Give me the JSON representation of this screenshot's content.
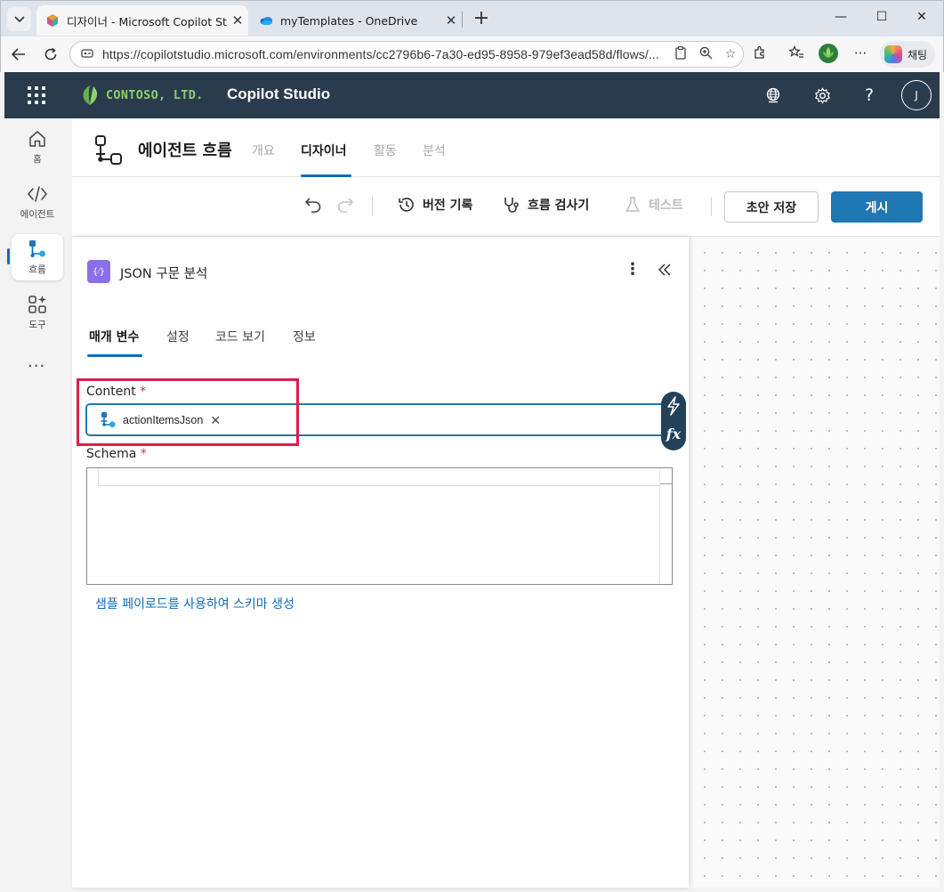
{
  "browser": {
    "tabs": [
      {
        "title": "디자이너 - Microsoft Copilot Studio",
        "close": "✕"
      },
      {
        "title": "myTemplates - OneDrive",
        "close": "✕"
      }
    ],
    "new_tab": "+",
    "window_controls": {
      "minimize": "—",
      "maximize": "☐",
      "close": "✕"
    },
    "url": "https://copilotstudio.microsoft.com/environments/cc2796b6-7a30-ed95-8958-979ef3ead58d/flows/...",
    "chat_label": "채팅",
    "more": "···"
  },
  "app": {
    "brand": "CONTOSO, LTD.",
    "title": "Copilot Studio",
    "avatar_initial": "J",
    "help": "?"
  },
  "rail": {
    "items": [
      {
        "label": "홈",
        "icon": "home-icon"
      },
      {
        "label": "에이전트",
        "icon": "code-icon"
      },
      {
        "label": "흐름",
        "icon": "flow-icon"
      },
      {
        "label": "도구",
        "icon": "tools-icon"
      }
    ],
    "more": "···"
  },
  "page": {
    "title": "에이전트 흐름",
    "tabs": [
      "개요",
      "디자이너",
      "활동",
      "분석"
    ],
    "active_tab": "디자이너"
  },
  "toolbar": {
    "version_history": "버전 기록",
    "flow_checker": "흐름 검사기",
    "test": "테스트",
    "save_draft": "초안 저장",
    "publish": "게시"
  },
  "panel": {
    "action_icon_text": "{⁄}",
    "action_title": "JSON 구문 분석",
    "tabs": [
      "매개 변수",
      "설정",
      "코드 보기",
      "정보"
    ],
    "active_tab": "매개 변수",
    "content_label": "Content",
    "required_mark": "*",
    "content_token": "actionItemsJson",
    "token_remove": "✕",
    "fx": "fx",
    "schema_label": "Schema",
    "generate_link": "샘플 페이로드를 사용하여 스키마 생성"
  },
  "colors": {
    "app_header": "#2b3b4e",
    "brand_green": "#8cd06a",
    "primary": "#1f78b4",
    "highlight": "#dc1e4b",
    "required": "#c4314b"
  }
}
